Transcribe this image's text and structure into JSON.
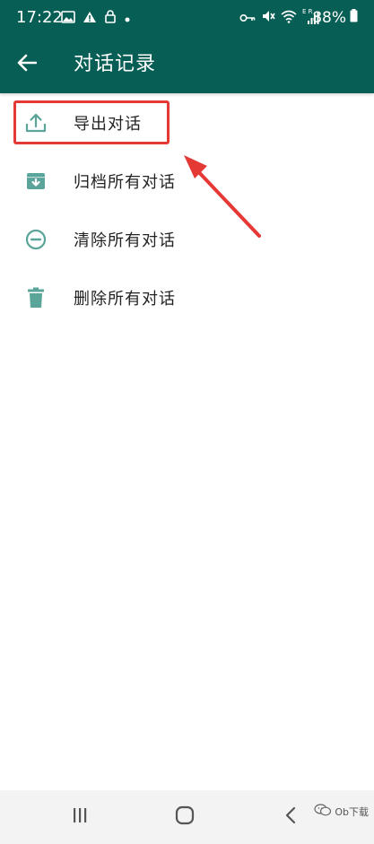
{
  "status_bar": {
    "time": "17:22",
    "battery": "88%",
    "signal_prefix": "E R",
    "icons_left": [
      "image-icon",
      "alert-icon",
      "lock-icon",
      "dot-icon"
    ],
    "icons_right": [
      "key-icon",
      "mute-icon",
      "wifi-icon",
      "signal-icon"
    ]
  },
  "app_bar": {
    "title": "对话记录",
    "back_icon": "arrow-left-icon"
  },
  "menu": {
    "items": [
      {
        "label": "导出对话",
        "icon": "upload-icon"
      },
      {
        "label": "归档所有对话",
        "icon": "archive-icon"
      },
      {
        "label": "清除所有对话",
        "icon": "minus-circle-icon"
      },
      {
        "label": "删除所有对话",
        "icon": "trash-icon"
      }
    ]
  },
  "annotation": {
    "highlight_color": "#e53935"
  },
  "nav_bar": {
    "buttons": [
      "recent-apps-icon",
      "home-icon",
      "back-icon"
    ]
  },
  "watermark": {
    "text": "Ob下载"
  },
  "colors": {
    "app_bar": "#075e54",
    "icon_accent": "#5aa49a"
  }
}
